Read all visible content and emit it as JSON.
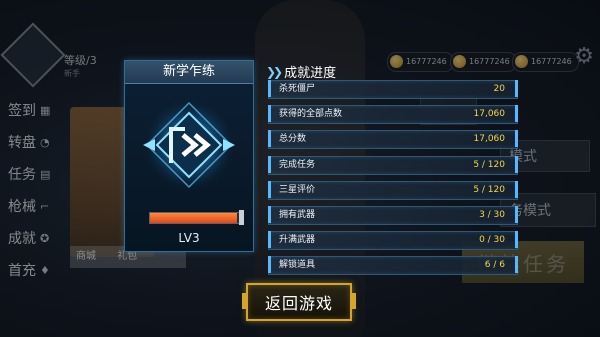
{
  "background": {
    "level_label": "等级/3",
    "level_sub": "新手",
    "resources": [
      "16777246",
      "16777246",
      "16777246"
    ],
    "sidebar": [
      {
        "label": "签到",
        "icon": "calendar-icon"
      },
      {
        "label": "转盘",
        "icon": "pie-icon"
      },
      {
        "label": "任务",
        "icon": "task-icon"
      },
      {
        "label": "枪械",
        "icon": "gun-icon"
      },
      {
        "label": "成就",
        "icon": "star-icon"
      },
      {
        "label": "首充",
        "icon": "gift-icon"
      }
    ],
    "shop_label": "商城",
    "gift_label": "礼包",
    "mode_buttons": [
      "模式",
      "务模式"
    ],
    "continue_label": "继续任务"
  },
  "rank": {
    "title": "新学乍练",
    "level": "LV3",
    "xp_fraction": 0.95
  },
  "achievements": {
    "title": "成就进度",
    "rows": [
      {
        "label": "杀死僵尸",
        "value": "20"
      },
      {
        "label": "获得的全部点数",
        "value": "17,060"
      },
      {
        "label": "总分数",
        "value": "17,060"
      },
      {
        "label": "完成任务",
        "value": "5 / 120"
      },
      {
        "label": "三星评价",
        "value": "5 / 120"
      },
      {
        "label": "拥有武器",
        "value": "3 / 30"
      },
      {
        "label": "升满武器",
        "value": "0 / 30"
      },
      {
        "label": "解锁道具",
        "value": "6 / 6"
      }
    ]
  },
  "return_button": "返回游戏",
  "colors": {
    "accent_blue": "#57b7ff",
    "value_yellow": "#f4d64b",
    "gold_border": "#d4a52c",
    "xp_orange": "#e0481b"
  }
}
